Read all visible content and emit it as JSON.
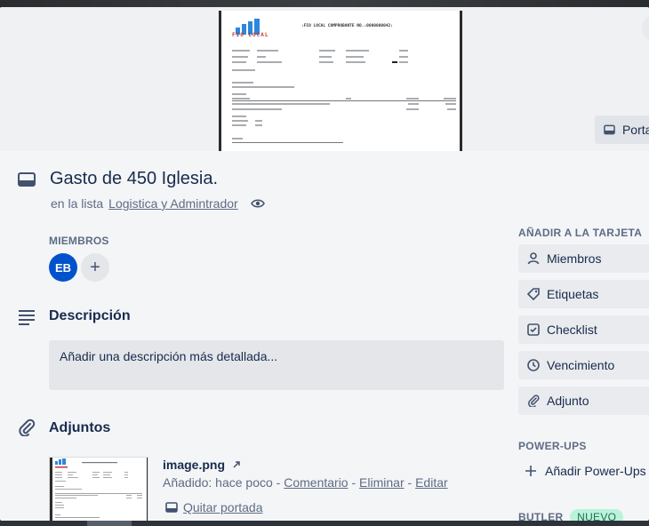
{
  "cover": {
    "doc_logo_text": "FIO LOCAL",
    "doc_title": ":FIO LOCAL COMPROBANTE NO.:0000000042:",
    "button_label": "Portada"
  },
  "card": {
    "title": "Gasto de 450 Iglesia.",
    "list_prefix": "en la lista",
    "list_name": "Logistica y Admintrador"
  },
  "members": {
    "heading": "MIEMBROS",
    "avatar_initials": "EB",
    "add_symbol": "+"
  },
  "description": {
    "heading": "Descripción",
    "placeholder": "Añadir una descripción más detallada..."
  },
  "attachments": {
    "heading": "Adjuntos",
    "file_name": "image.png",
    "added_label": "Añadido: hace poco",
    "sep": "-",
    "comment_link": "Comentario",
    "delete_link": "Eliminar",
    "edit_link": "Editar",
    "remove_cover": "Quitar portada"
  },
  "sidebar": {
    "add_heading": "AÑADIR A LA TARJETA",
    "buttons": [
      {
        "label": "Miembros",
        "icon": "person-icon"
      },
      {
        "label": "Etiquetas",
        "icon": "tag-icon"
      },
      {
        "label": "Checklist",
        "icon": "checkbox-icon"
      },
      {
        "label": "Vencimiento",
        "icon": "clock-icon"
      },
      {
        "label": "Adjunto",
        "icon": "paperclip-icon"
      }
    ],
    "powerups_heading": "POWER-UPS",
    "add_powerups": "Añadir Power-Ups",
    "butler_heading": "BUTLER",
    "new_badge": "NUEVO"
  },
  "colors": {
    "avatar": "#0052cc",
    "badge_bg": "#baf3db",
    "badge_fg": "#216e4e"
  }
}
